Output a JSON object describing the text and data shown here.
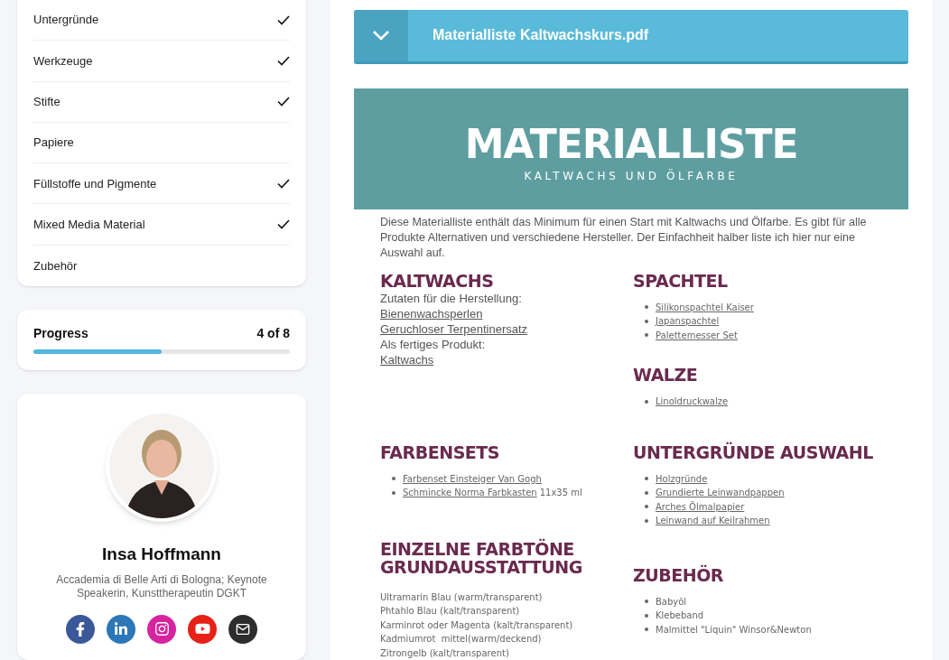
{
  "lessons": [
    {
      "label": "Untergründe",
      "checked": true
    },
    {
      "label": "Werkzeuge",
      "checked": true
    },
    {
      "label": "Stifte",
      "checked": true
    },
    {
      "label": "Papiere",
      "checked": false
    },
    {
      "label": "Füllstoffe und Pigmente",
      "checked": true
    },
    {
      "label": "Mixed Media Material",
      "checked": true
    },
    {
      "label": "Zubehör",
      "checked": false
    }
  ],
  "progress": {
    "label": "Progress",
    "count": "4 of 8",
    "level": 0.5
  },
  "author": {
    "name": "Insa Hoffmann",
    "bio": "Accademia di Belle Arti di Bologna; Keynote Speakerin, Kunsttherapeutin DGKT",
    "social": [
      {
        "kind": "facebook",
        "color": "#3b5998"
      },
      {
        "kind": "linkedin",
        "color": "#2b77b7"
      },
      {
        "kind": "instagram",
        "color": "#d6249f"
      },
      {
        "kind": "youtube",
        "color": "#e62117"
      },
      {
        "kind": "email",
        "color": "#2d2d2d"
      }
    ]
  },
  "attachment": {
    "title": "Materialliste Kaltwachskurs.pdf",
    "expanded": true
  },
  "document": {
    "title": "MATERIALLISTE",
    "subtitle": "KALTWACHS UND ÖLFARBE",
    "intro": "Diese Materialliste enthält das Minimum für einen Start mit Kaltwachs und Ölfarbe. Es gibt für alle Produkte Alternativen und verschiedene Hersteller. Der Einfachheit halber liste ich hier nur eine Auswahl auf.",
    "columns": [
      [
        {
          "heading": "KALTWACHS",
          "kind": "lines",
          "items": [
            {
              "text": "Zutaten für die Herstellung:",
              "link": false
            },
            {
              "text": "Bienenwachsperlen",
              "link": true
            },
            {
              "text": "Geruchloser Terpentinersatz",
              "link": true
            },
            {
              "text": "Als fertiges Produkt:",
              "link": false
            },
            {
              "text": "Kaltwachs ",
              "link": true
            }
          ]
        },
        {
          "heading": "FARBENSETS",
          "kind": "bullets",
          "items": [
            {
              "text": "Farbenset Einsteiger Van Gogh",
              "link": true
            },
            {
              "text": "Schmincke Norma Farbkasten",
              "link": true,
              "suffix": "11x35 ml"
            }
          ]
        },
        {
          "heading": "EINZELNE FARBTÖNE GRUNDAUSSTATTUNG",
          "kind": "small",
          "items": [
            {
              "text": "Ultramarin Blau (warm/transparent)"
            },
            {
              "text": "Phtahlo Blau (kalt/transparent)"
            },
            {
              "text": "Karminrot oder Magenta (kalt/transparent)"
            },
            {
              "text": "Kadmiumrot  mittel(warm/deckend)"
            },
            {
              "text": "Zitrongelb (kalt/transparent)"
            }
          ]
        }
      ],
      [
        {
          "heading": "SPACHTEL",
          "kind": "bullets",
          "items": [
            {
              "text": "Silikonspachtel Kaiser",
              "link": true
            },
            {
              "text": "Japanspachtel ",
              "link": true
            },
            {
              "text": "Palettemesser Set",
              "link": true
            }
          ]
        },
        {
          "heading": "WALZE",
          "kind": "bullets",
          "items": [
            {
              "text": "Linoldruckwalze",
              "link": true
            }
          ]
        },
        {
          "heading": "UNTERGRÜNDE AUSWAHL",
          "kind": "bullets",
          "items": [
            {
              "text": "Holzgründe",
              "link": true
            },
            {
              "text": "Grundierte Leinwandpappen",
              "link": true
            },
            {
              "text": "Arches Ölmalpapier",
              "link": true
            },
            {
              "text": "Leinwand auf Keilrahmen",
              "link": true
            }
          ]
        },
        {
          "heading": "ZUBEHÖR",
          "kind": "bullets",
          "items": [
            {
              "text": "Babyöl",
              "link": false
            },
            {
              "text": "Klebeband",
              "link": false
            },
            {
              "text": "Malmittel \"Liquin\" Winsor&Newton",
              "link": false
            }
          ]
        }
      ]
    ]
  }
}
